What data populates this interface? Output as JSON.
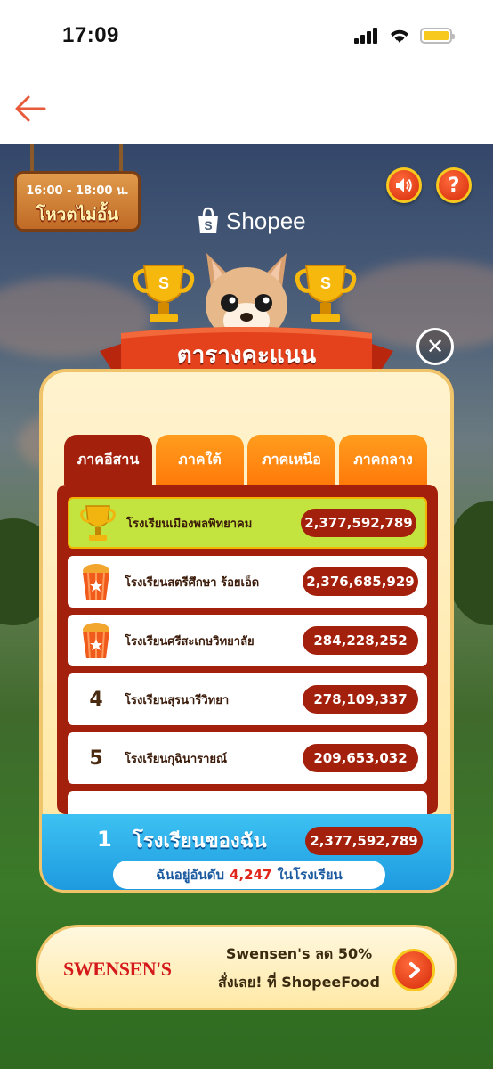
{
  "status_bar": {
    "time": "17:09"
  },
  "nav": {
    "back_icon": "arrow-left-icon"
  },
  "game": {
    "time_sign": {
      "time": "16:00 - 18:00 น.",
      "title": "โหวตไม่อั้น"
    },
    "brand": "Shopee",
    "title": "ตารางคะแนน",
    "tabs": [
      {
        "label": "ภาคอีสาน",
        "active": true
      },
      {
        "label": "ภาคใต้",
        "active": false
      },
      {
        "label": "ภาคเหนือ",
        "active": false
      },
      {
        "label": "ภาคกลาง",
        "active": false
      }
    ],
    "leaderboard": [
      {
        "rank": "1",
        "icon": "gold-trophy-icon",
        "name": "โรงเรียนเมืองพลพิทยาคม",
        "score": "2,377,592,789"
      },
      {
        "rank": "2",
        "icon": "popcorn-cup-icon",
        "name": "โรงเรียนสตรีศึกษา ร้อยเอ็ด",
        "score": "2,376,685,929"
      },
      {
        "rank": "3",
        "icon": "popcorn-cup-icon",
        "name": "โรงเรียนศรีสะเกษวิทยาลัย",
        "score": "284,228,252"
      },
      {
        "rank": "4",
        "icon": "",
        "name": "โรงเรียนสุรนารีวิทยา",
        "score": "278,109,337"
      },
      {
        "rank": "5",
        "icon": "",
        "name": "โรงเรียนกุฉินารายณ์",
        "score": "209,653,032"
      }
    ],
    "my_school": {
      "rank": "1",
      "label": "โรงเรียนของฉัน",
      "score": "2,377,592,789",
      "my_rank_prefix": "ฉันอยู่อันดับ",
      "my_rank_value": "4,247",
      "my_rank_suffix": "ในโรงเรียน"
    },
    "promo": {
      "logo": "SWENSEN'S",
      "line1": "Swensen's ลด 50%",
      "line2": "สั่งเลย! ที่ ShopeeFood"
    }
  },
  "colors": {
    "accent_red": "#a3200c",
    "tab_orange": "#ff8a12",
    "highlight_green": "#c3e33e",
    "my_bar_blue": "#2aaee8"
  }
}
